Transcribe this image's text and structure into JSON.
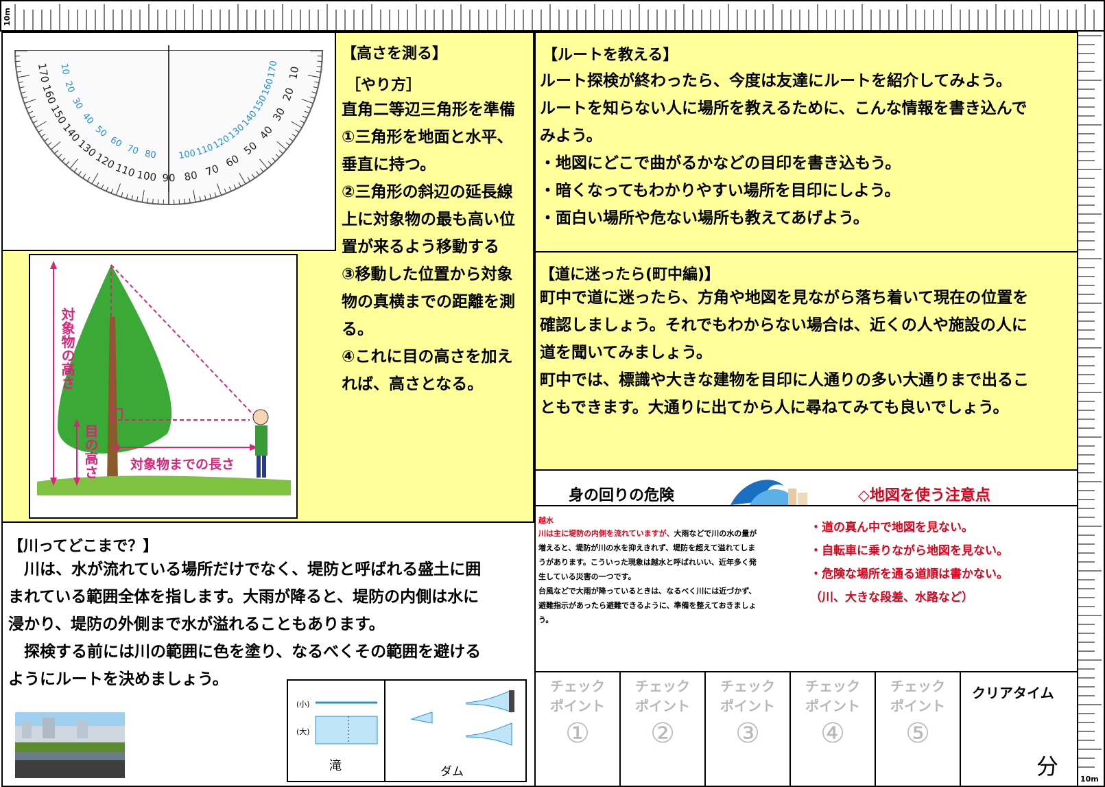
{
  "ruler": {
    "label": "10m"
  },
  "height": {
    "title": "【高さを測る】",
    "method": "［やり方］",
    "lines": [
      "直角二等辺三角形を準備",
      "①三角形を地面と水平、",
      "垂直に持つ。",
      "②三角形の斜辺の延長線",
      "上に対象物の最も高い位",
      "置が来るよう移動する",
      "③移動した位置から対象",
      "物の真横までの距離を測",
      "る。",
      "④これに目の高さを加え",
      "れば、高さとなる。"
    ]
  },
  "protractor": {
    "outer": [
      "10",
      "20",
      "30",
      "40",
      "50",
      "60",
      "70",
      "80",
      "90",
      "100",
      "110",
      "120",
      "130",
      "140",
      "150",
      "160",
      "170"
    ],
    "inner": [
      "170",
      "160",
      "150",
      "140",
      "130",
      "120",
      "110",
      "100",
      "80",
      "70",
      "60",
      "50",
      "40",
      "30",
      "20",
      "10"
    ]
  },
  "tree": {
    "label_height": "対象物の高さ",
    "label_eye": "目の高さ",
    "label_distance": "対象物までの長さ"
  },
  "route": {
    "title": "【ルートを教える】",
    "lines": [
      "ルート探検が終わったら、今度は友達にルートを紹介してみよう。",
      "ルートを知らない人に場所を教えるために、こんな情報を書き込んで",
      "みよう。"
    ],
    "bullets": [
      "・地図にどこで曲がるかなどの目印を書き込もう。",
      "・暗くなってもわかりやすい場所を目印にしよう。",
      "・面白い場所や危ない場所も教えてあげよう。"
    ]
  },
  "lost": {
    "title": "【道に迷ったら(町中編)】",
    "lines": [
      "町中で道に迷ったら、方角や地図を見ながら落ち着いて現在の位置を",
      "確認しましょう。それでもわからない場合は、近くの人や施設の人に",
      "道を聞いてみましょう。",
      "町中では、標識や大きな建物を目印に人通りの多い大通りまで出るこ",
      "ともできます。大通りに出てから人に尋ねてみても良いでしょう。"
    ]
  },
  "danger": {
    "title": "身の回りの危険",
    "heading": "越水",
    "intro_red": "川は主に堤防の内側を流れていますが、",
    "intro_black": "大雨などで川の水の量が",
    "lines": [
      "増えると、堤防が川の水を抑えきれず、堤防を超えて溢れてしま",
      "うがあります。こういった現象は越水と呼ばれいい、近年多く発",
      "生している災害の一つです。",
      "台風などで大雨が降っているときは、なるべく川には近づかず、",
      "避難指示があったら避難できるように、準備を整えておきましょ",
      "う。"
    ]
  },
  "caution": {
    "title": "◇地図を使う注意点",
    "items": [
      "・道の真ん中で地図を見ない。",
      "・自転車に乗りながら地図を見ない。",
      "・危険な場所を通る道順は書かない。",
      "（川、大きな段差、水路など）"
    ]
  },
  "river": {
    "title": "【川ってどこまで？】",
    "lines": [
      "　川は、水が流れている場所だけでなく、堤防と呼ばれる盛土に囲",
      "まれている範囲全体を指します。大雨が降ると、堤防の内側は水に",
      "浸かり、堤防の外側まで水が溢れることもあります。",
      "　探検する前には川の範囲に色を塗り、なるべくその範囲を避ける",
      "ようにルートを決めましょう。"
    ],
    "diagram": {
      "small": "(小)",
      "large": "(大)",
      "waterfall": "滝",
      "dam": "ダム"
    }
  },
  "checkpoints": {
    "label1": "チェック",
    "label2": "ポイント",
    "numbers": [
      "①",
      "②",
      "③",
      "④",
      "⑤"
    ],
    "clear_time": "クリアタイム",
    "minutes": "分"
  }
}
